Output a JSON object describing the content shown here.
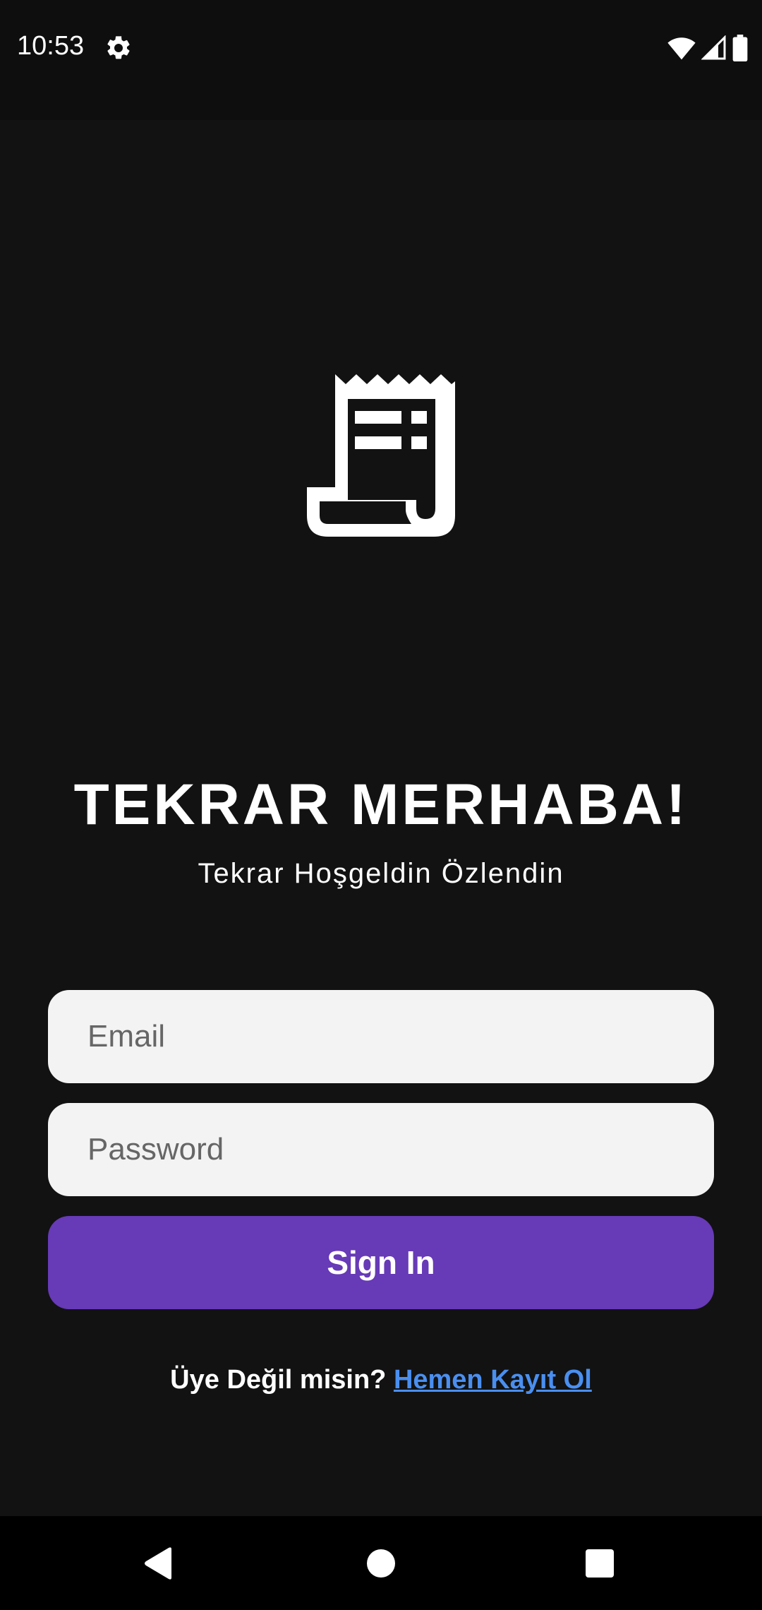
{
  "status_bar": {
    "time": "10:53",
    "icons": [
      "gear-icon",
      "wifi-icon",
      "signal-icon",
      "battery-icon"
    ]
  },
  "app": {
    "logo_icon": "receipt-icon",
    "title": "TEKRAR MERHABA!",
    "subtitle": "Tekrar Hoşgeldin Özlendin",
    "email_placeholder": "Email",
    "password_placeholder": "Password",
    "signin_label": "Sign In",
    "register_question": "Üye Değil misin?",
    "register_link": "Hemen Kayıt Ol"
  },
  "nav_bar": {
    "icons": [
      "back-icon",
      "home-icon",
      "recents-icon"
    ]
  },
  "colors": {
    "background": "#121212",
    "status_bar": "#0e0e0e",
    "field": "#f3f3f3",
    "accent": "#673ab7",
    "link": "#4a8ff0"
  }
}
